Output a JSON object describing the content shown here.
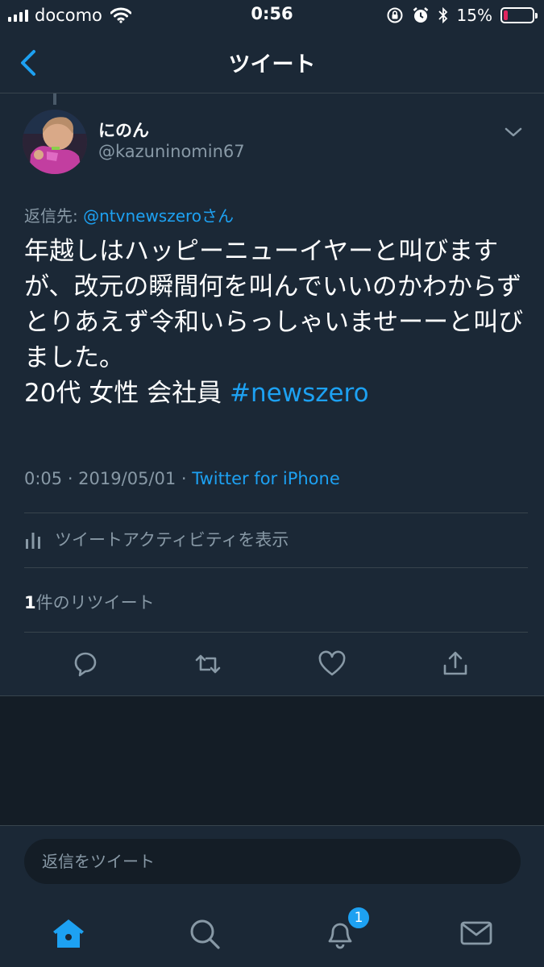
{
  "status_bar": {
    "carrier": "docomo",
    "time": "0:56",
    "battery_percent": "15%",
    "battery_level": 0.15
  },
  "nav": {
    "title": "ツイート"
  },
  "tweet": {
    "display_name": "にのん",
    "handle": "@kazuninomin67",
    "reply_prefix": "返信先: ",
    "reply_mention": "@ntvnewszeroさん",
    "text": "年越しはハッピーニューイヤーと叫びますが、改元の瞬間何を叫んでいいのかわからずとりあえず令和いらっしゃいませーーと叫びました。\n20代 女性 会社員 ",
    "hashtag": "#newszero",
    "timestamp": "0:05 · 2019/05/01 · ",
    "source": "Twitter for iPhone",
    "activity_label": "ツイートアクティビティを表示",
    "retweet_count": "1",
    "retweet_label": "件のリツイート"
  },
  "reply_box": {
    "placeholder": "返信をツイート"
  },
  "tab_bar": {
    "notification_badge": "1"
  },
  "colors": {
    "accent": "#1da1f2",
    "background": "#141d26",
    "panel": "#1b2836",
    "secondary_text": "#8899a6"
  },
  "icons": [
    "signal-icon",
    "wifi-icon",
    "lock-rotation-icon",
    "alarm-icon",
    "bluetooth-icon",
    "battery-icon",
    "back-chevron-icon",
    "chevron-down-icon",
    "bar-chart-icon",
    "reply-icon",
    "retweet-icon",
    "like-icon",
    "share-icon",
    "home-icon",
    "search-icon",
    "notifications-icon",
    "messages-icon"
  ]
}
